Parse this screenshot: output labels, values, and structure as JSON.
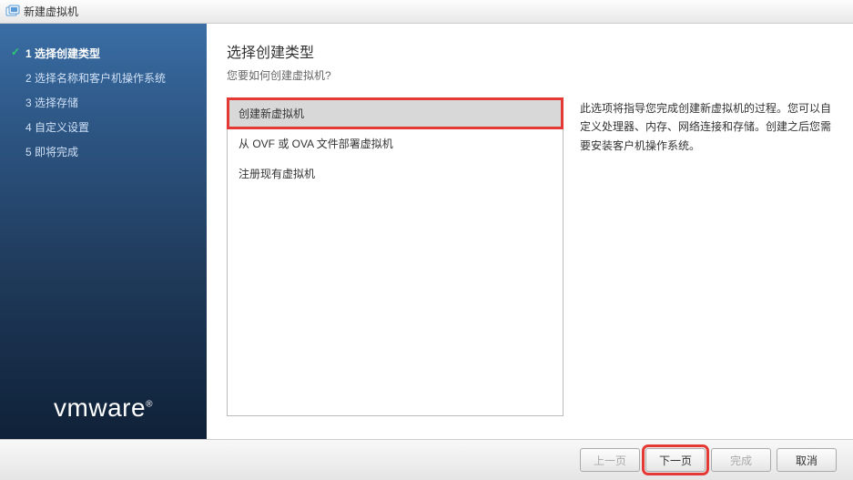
{
  "window": {
    "title": "新建虚拟机"
  },
  "sidebar": {
    "steps": [
      {
        "label": "1 选择创建类型",
        "active": true
      },
      {
        "label": "2 选择名称和客户机操作系统",
        "active": false
      },
      {
        "label": "3 选择存储",
        "active": false
      },
      {
        "label": "4 自定义设置",
        "active": false
      },
      {
        "label": "5 即将完成",
        "active": false
      }
    ],
    "logo": "vmware"
  },
  "content": {
    "heading": "选择创建类型",
    "subheading": "您要如何创建虚拟机?",
    "options": [
      {
        "label": "创建新虚拟机",
        "selected": true
      },
      {
        "label": "从 OVF 或 OVA 文件部署虚拟机",
        "selected": false
      },
      {
        "label": "注册现有虚拟机",
        "selected": false
      }
    ],
    "description": "此选项将指导您完成创建新虚拟机的过程。您可以自定义处理器、内存、网络连接和存储。创建之后您需要安装客户机操作系统。"
  },
  "footer": {
    "back": "上一页",
    "next": "下一页",
    "finish": "完成",
    "cancel": "取消"
  }
}
